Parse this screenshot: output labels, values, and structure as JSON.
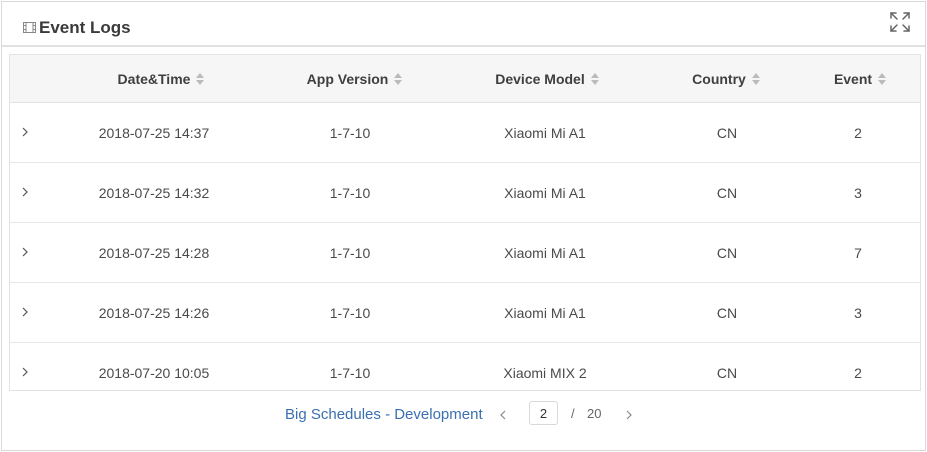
{
  "panel": {
    "title": "Event Logs",
    "title_icon": "film-icon",
    "expand_icon": "expand-icon"
  },
  "table": {
    "columns": [
      "Date&Time",
      "App Version",
      "Device Model",
      "Country",
      "Event"
    ],
    "rows": [
      [
        "2018-07-25 14:37",
        "1-7-10",
        "Xiaomi Mi A1",
        "CN",
        "2"
      ],
      [
        "2018-07-25 14:32",
        "1-7-10",
        "Xiaomi Mi A1",
        "CN",
        "3"
      ],
      [
        "2018-07-25 14:28",
        "1-7-10",
        "Xiaomi Mi A1",
        "CN",
        "7"
      ],
      [
        "2018-07-25 14:26",
        "1-7-10",
        "Xiaomi Mi A1",
        "CN",
        "3"
      ],
      [
        "2018-07-20 10:05",
        "1-7-10",
        "Xiaomi MIX 2",
        "CN",
        "2"
      ]
    ]
  },
  "pager": {
    "link_label": "Big Schedules - Development",
    "current_page": "2",
    "separator": "/",
    "total_pages": "20"
  },
  "colors": {
    "link": "#3a6fb0",
    "header_bg": "#f6f6f6",
    "border": "#e3e3e3"
  }
}
